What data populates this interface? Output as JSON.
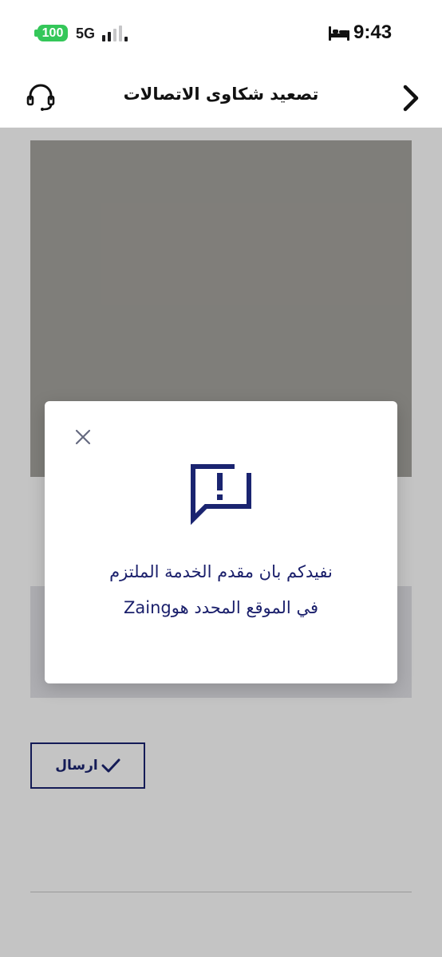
{
  "status_bar": {
    "battery": "100",
    "network": "5G",
    "time": "9:43"
  },
  "header": {
    "title": "تصعيد شكاوى الاتصالات"
  },
  "content": {
    "send_button_label": "ارسال"
  },
  "modal": {
    "message_line1": "نفيدكم بان مقدم الخدمة الملتزم",
    "message_line2": "في الموقع المحدد هوZaing"
  },
  "colors": {
    "accent": "#1a2470",
    "battery": "#34c759",
    "image_placeholder": "#a6a49f"
  },
  "icons": {
    "header_left": "headset-icon",
    "header_right": "chevron-right-icon",
    "modal_close": "close-icon",
    "modal_alert": "alert-chat-icon",
    "button": "checkmark-icon"
  }
}
